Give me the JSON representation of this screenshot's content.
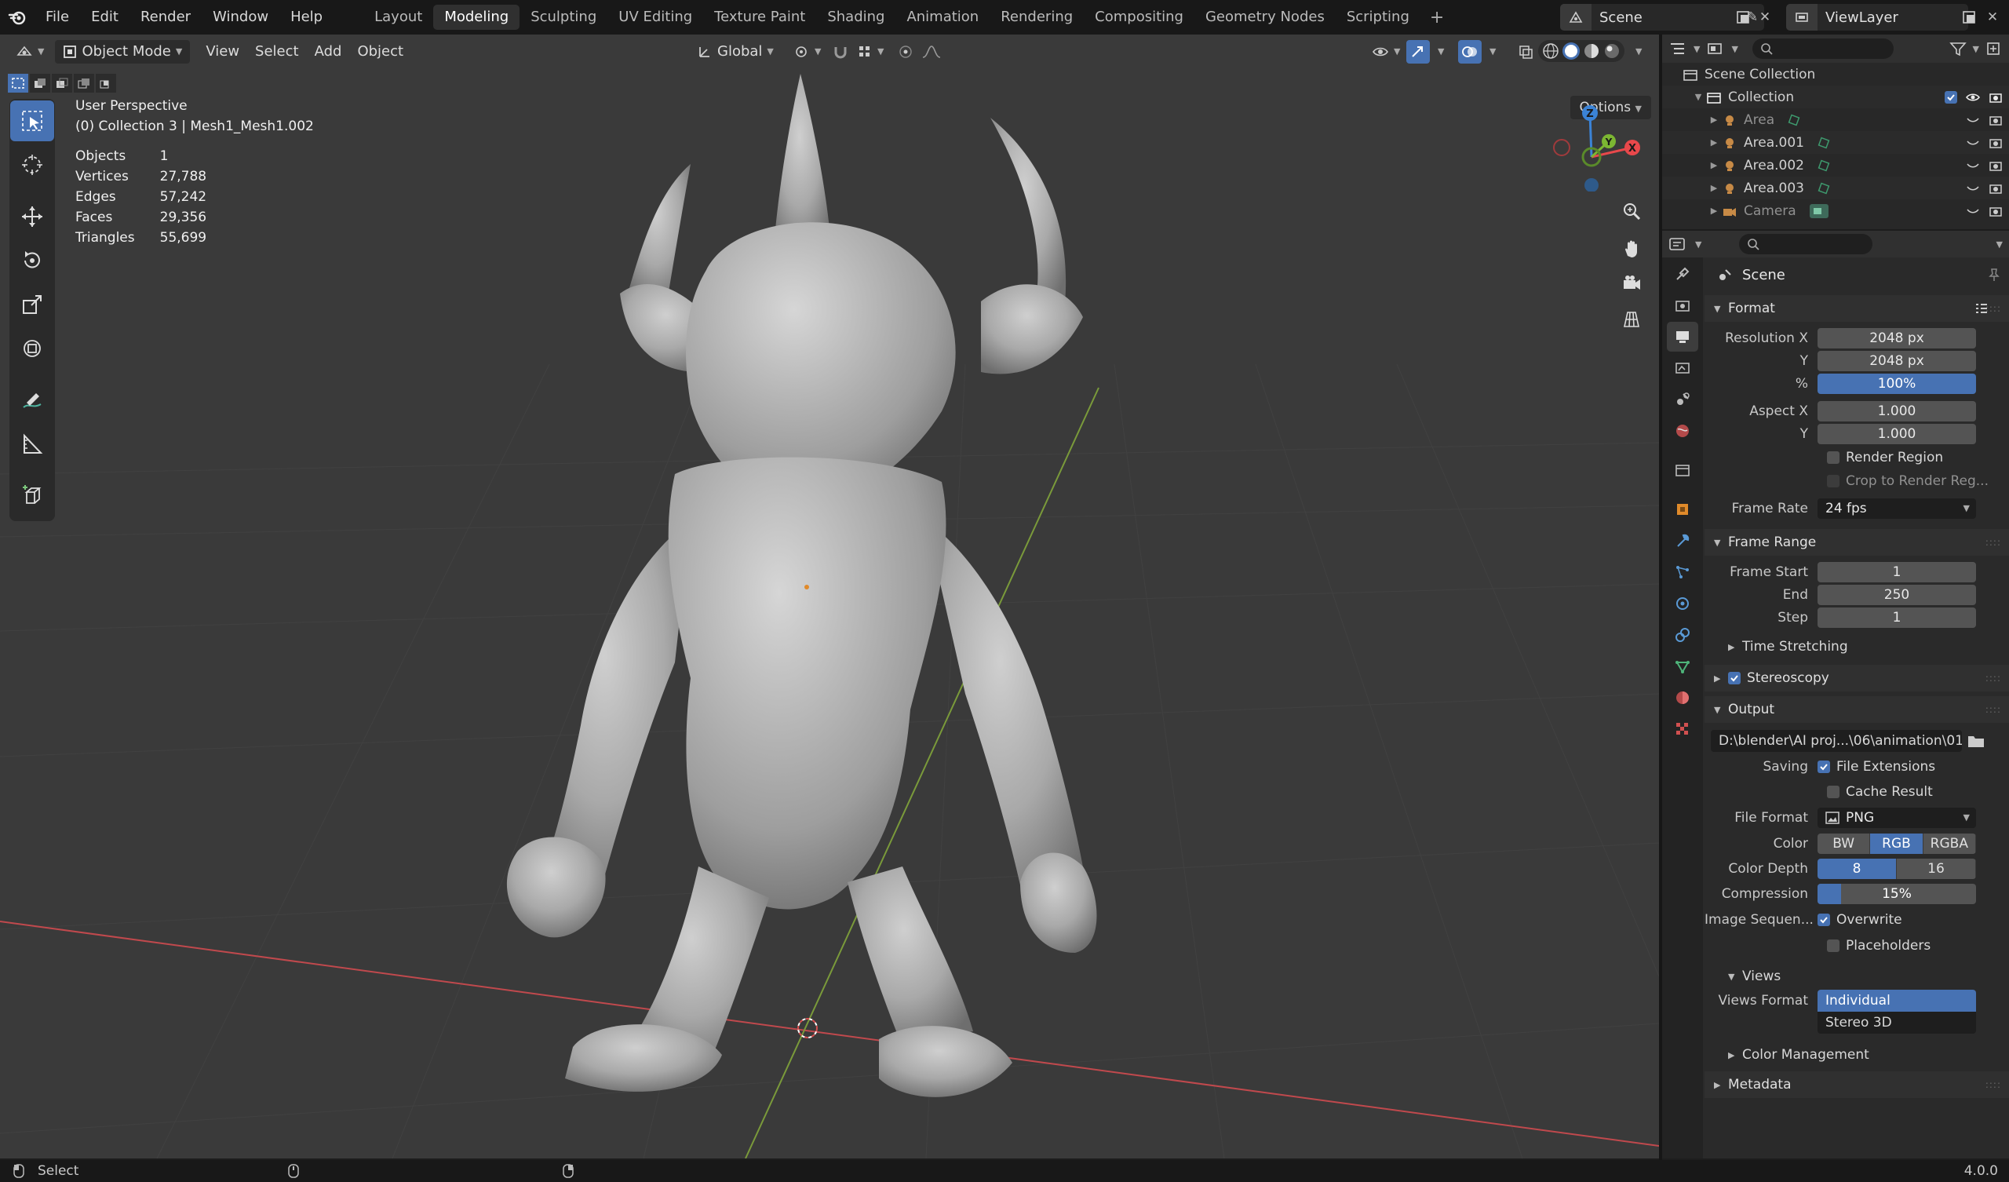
{
  "menubar": {
    "items": [
      "File",
      "Edit",
      "Render",
      "Window",
      "Help"
    ],
    "workspaces": [
      "Layout",
      "Modeling",
      "Sculpting",
      "UV Editing",
      "Texture Paint",
      "Shading",
      "Animation",
      "Rendering",
      "Compositing",
      "Geometry Nodes",
      "Scripting"
    ],
    "active_workspace": "Modeling",
    "scene": "Scene",
    "view_layer": "ViewLayer"
  },
  "viewport_header": {
    "mode": "Object Mode",
    "menus": [
      "View",
      "Select",
      "Add",
      "Object"
    ],
    "orientation": "Global",
    "options": "Options"
  },
  "viewport": {
    "view_name": "User Perspective",
    "collection_info": "(0) Collection 3 | Mesh1_Mesh1.002",
    "stats": [
      {
        "label": "Objects",
        "value": "1"
      },
      {
        "label": "Vertices",
        "value": "27,788"
      },
      {
        "label": "Edges",
        "value": "57,242"
      },
      {
        "label": "Faces",
        "value": "29,356"
      },
      {
        "label": "Triangles",
        "value": "55,699"
      }
    ],
    "gizmo_axes": {
      "x": "X",
      "y": "Y",
      "z": "Z"
    }
  },
  "outliner": {
    "root": "Scene Collection",
    "collection": "Collection",
    "items": [
      {
        "name": "Area",
        "dim": true
      },
      {
        "name": "Area.001",
        "dim": false
      },
      {
        "name": "Area.002",
        "dim": false
      },
      {
        "name": "Area.003",
        "dim": false
      },
      {
        "name": "Camera",
        "dim": true
      }
    ]
  },
  "properties": {
    "context": "Scene",
    "format": {
      "title": "Format",
      "resolution_x_label": "Resolution X",
      "resolution_x": "2048 px",
      "y_label": "Y",
      "resolution_y": "2048 px",
      "pct_label": "%",
      "resolution_pct": "100%",
      "aspect_x_label": "Aspect X",
      "aspect_x": "1.000",
      "aspect_y": "1.000",
      "render_region": "Render Region",
      "crop": "Crop to Render Reg...",
      "frame_rate_label": "Frame Rate",
      "frame_rate": "24 fps"
    },
    "frame_range": {
      "title": "Frame Range",
      "start_label": "Frame Start",
      "start": "1",
      "end_label": "End",
      "end": "250",
      "step_label": "Step",
      "step": "1",
      "time_stretching": "Time Stretching"
    },
    "stereoscopy": "Stereoscopy",
    "output": {
      "title": "Output",
      "path": "D:\\blender\\AI proj...\\06\\animation\\01",
      "saving_label": "Saving",
      "file_extensions": "File Extensions",
      "cache_result": "Cache Result",
      "file_format_label": "File Format",
      "file_format": "PNG",
      "color_label": "Color",
      "color_options": [
        "BW",
        "RGB",
        "RGBA"
      ],
      "color_selected": "RGB",
      "color_depth_label": "Color Depth",
      "color_depth_options": [
        "8",
        "16"
      ],
      "color_depth_selected": "8",
      "compression_label": "Compression",
      "compression": "15%",
      "compression_level": 0.15,
      "image_seq_label": "Image Sequen...",
      "overwrite": "Overwrite",
      "placeholders": "Placeholders",
      "views_title": "Views",
      "views_format_label": "Views Format",
      "views_format_options": [
        "Individual",
        "Stereo 3D"
      ],
      "views_format_selected": "Individual"
    },
    "color_management": "Color Management",
    "metadata": "Metadata"
  },
  "statusbar": {
    "left": "Select",
    "version": "4.0.0"
  },
  "colors": {
    "accent": "#4772b3",
    "x_axis": "#e8484b",
    "y_axis": "#7cb632",
    "z_axis": "#3b83d6"
  }
}
